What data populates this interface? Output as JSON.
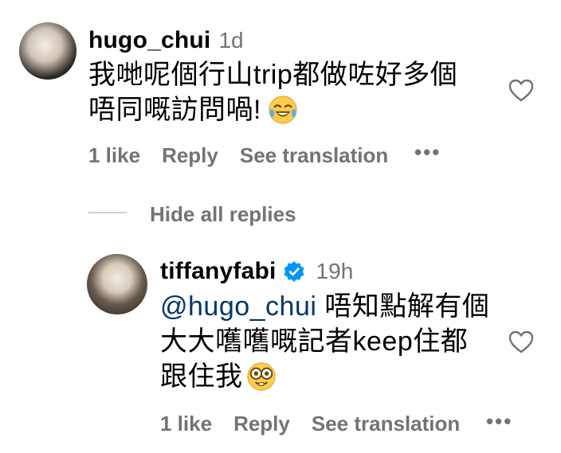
{
  "comment": {
    "username": "hugo_chui",
    "time": "1d",
    "line1": "我哋呢個行山trip都做咗好多個",
    "line2": "唔同嘅訪問喎!",
    "likes": "1 like",
    "reply": "Reply",
    "translate": "See translation"
  },
  "replies_toggle": "Hide all replies",
  "reply_comment": {
    "username": "tiffanyfabi",
    "time": "19h",
    "mention": "@hugo_chui",
    "line1_rest": " 唔知點解有個",
    "line2": "大大嚿嚿嘅記者keep住都",
    "line3": "跟住我",
    "likes": "1 like",
    "reply": "Reply",
    "translate": "See translation"
  },
  "icons": {
    "comment_like": "heart-outline-icon",
    "reply_like": "heart-outline-icon",
    "more": "more-options-icon",
    "verified": "verified-badge-icon",
    "emoji_laugh": "face-with-tears-of-joy-emoji",
    "emoji_nerd": "nerd-face-emoji"
  },
  "colors": {
    "username": "#000000",
    "meta": "#737373",
    "mention": "#00376b",
    "verified": "#0095f6",
    "divider": "#d0d0d0"
  }
}
